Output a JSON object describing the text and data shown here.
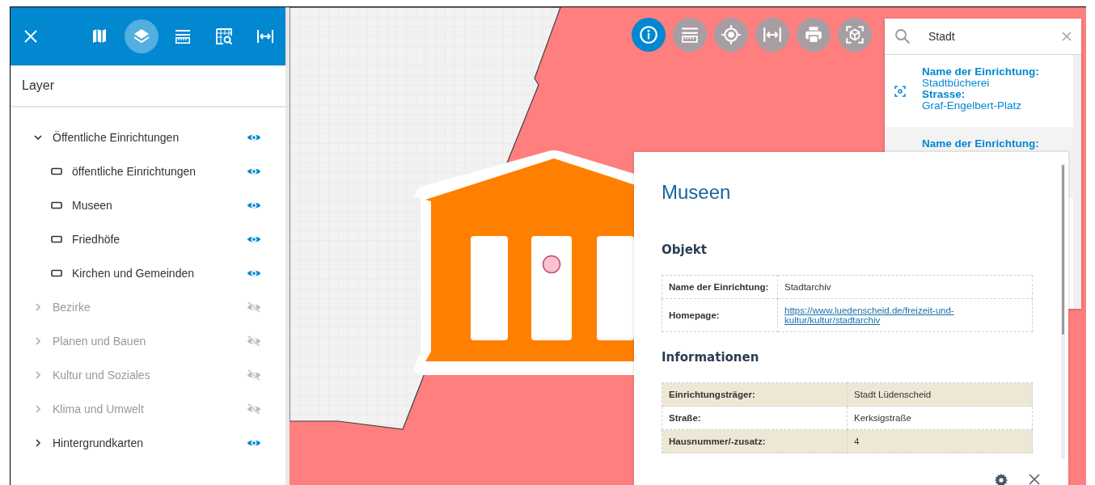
{
  "sidebar": {
    "tools": [
      {
        "kind": "map",
        "selected": false
      },
      {
        "kind": "layers",
        "selected": true
      },
      {
        "kind": "ruler",
        "selected": false
      },
      {
        "kind": "grid-search",
        "selected": false
      },
      {
        "kind": "measure",
        "selected": false
      }
    ],
    "title": "Layer",
    "layers": [
      {
        "kind": "group",
        "label": "Öffentliche Einrichtungen",
        "expanded": true,
        "visible": true,
        "children": [
          {
            "kind": "layer",
            "label": "öffentliche Einrichtungen",
            "visible": true
          },
          {
            "kind": "layer",
            "label": "Museen",
            "visible": true
          },
          {
            "kind": "layer",
            "label": "Friedhöfe",
            "visible": true
          },
          {
            "kind": "layer",
            "label": "Kirchen und Gemeinden",
            "visible": true
          }
        ]
      },
      {
        "kind": "group",
        "label": "Bezirke",
        "expanded": false,
        "visible": false
      },
      {
        "kind": "group",
        "label": "Planen und Bauen",
        "expanded": false,
        "visible": false
      },
      {
        "kind": "group",
        "label": "Kultur und Soziales",
        "expanded": false,
        "visible": false
      },
      {
        "kind": "group",
        "label": "Klima und Umwelt",
        "expanded": false,
        "visible": false
      },
      {
        "kind": "group",
        "label": "Hintergrundkarten",
        "expanded": false,
        "visible": true
      }
    ]
  },
  "map_toolbar": [
    {
      "kind": "info",
      "selected": true
    },
    {
      "kind": "ruler",
      "selected": false
    },
    {
      "kind": "locate",
      "selected": false
    },
    {
      "kind": "measure",
      "selected": false
    },
    {
      "kind": "print",
      "selected": false
    },
    {
      "kind": "cube",
      "selected": false
    }
  ],
  "search": {
    "value": "Stadt",
    "results": [
      {
        "fields": [
          {
            "label": "Name der Einrichtung:",
            "value": "Stadtbücherei"
          },
          {
            "label": "Strasse:",
            "value": "Graf-Engelbert-Platz"
          }
        ]
      },
      {
        "fields": [
          {
            "label": "Name der Einrichtung:"
          }
        ]
      }
    ]
  },
  "popup": {
    "title": "Museen",
    "sections": [
      {
        "heading": "Objekt",
        "rows": [
          {
            "label": "Name der Einrichtung:",
            "value": "Stadtarchiv",
            "kind": "text",
            "shaded": false
          },
          {
            "label": "Homepage:",
            "value": "https://www.luedenscheid.de/freizeit-und-kultur/kultur/stadtarchiv",
            "kind": "link",
            "shaded": false
          }
        ]
      },
      {
        "heading": "Informationen",
        "rows": [
          {
            "label": "Einrichtungsträger:",
            "value": "Stadt Lüdenscheid",
            "kind": "text",
            "shaded": true
          },
          {
            "label": "Straße:",
            "value": "Kerksigstraße",
            "kind": "text",
            "shaded": false
          },
          {
            "label": "Hausnummer/-zusatz:",
            "value": "4",
            "kind": "text",
            "shaded": true
          }
        ]
      }
    ]
  }
}
